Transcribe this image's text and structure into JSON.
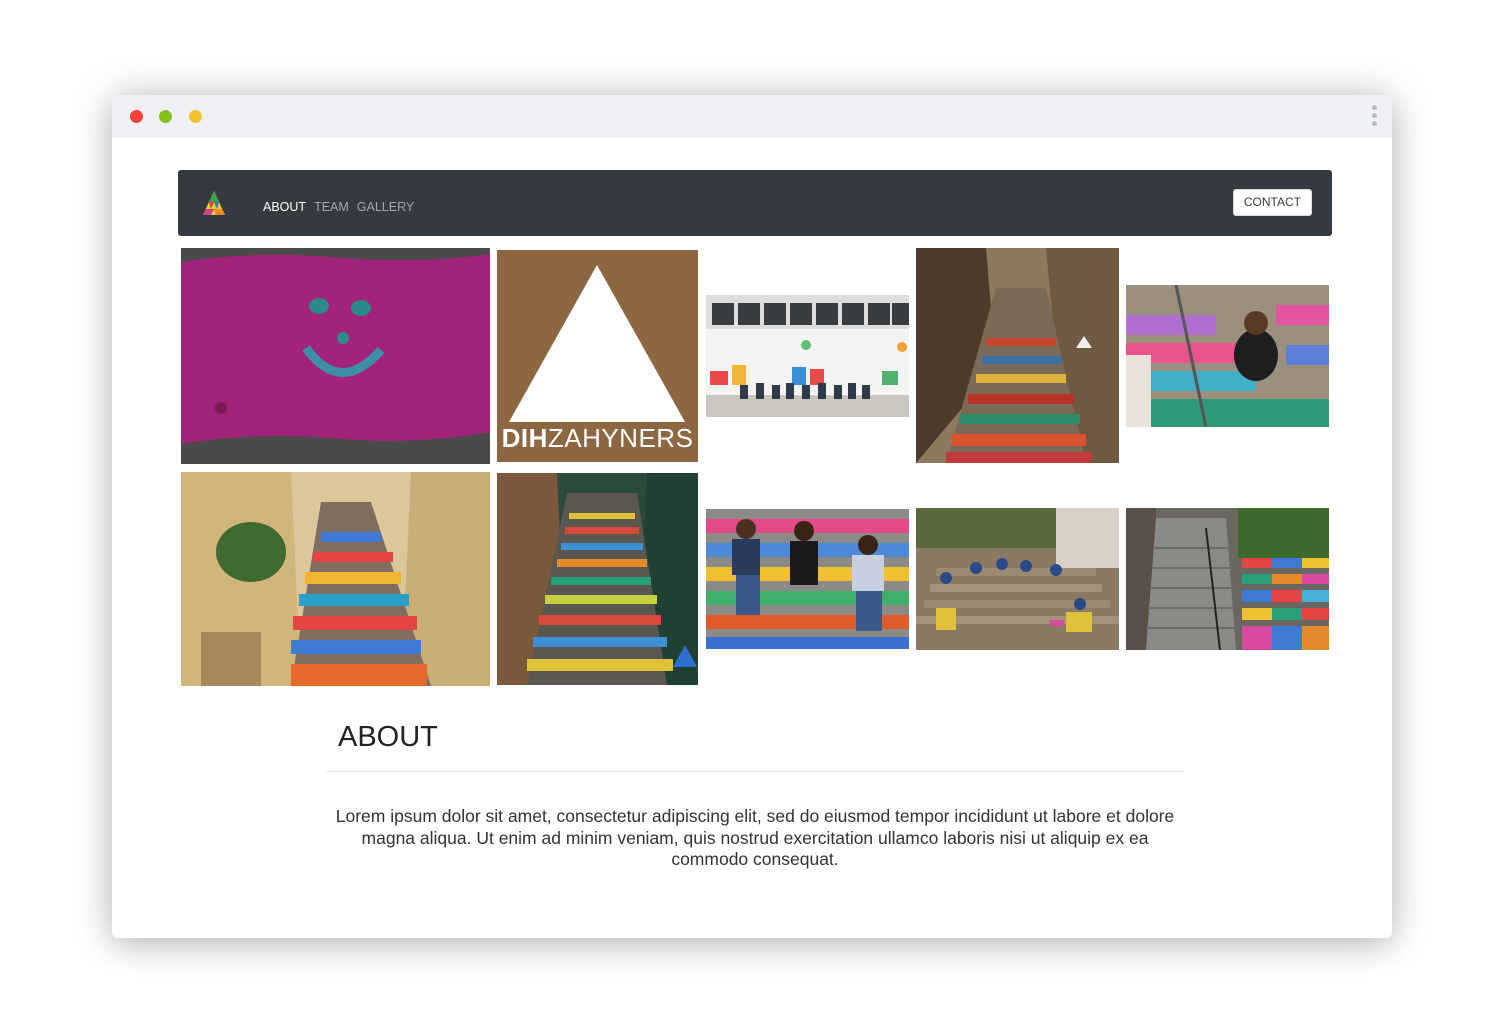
{
  "navbar": {
    "links": [
      "ABOUT",
      "TEAM",
      "GALLERY"
    ],
    "active_link": "ABOUT",
    "contact_label": "CONTACT"
  },
  "gallery": {
    "logo_tile_text": {
      "bold": "DIH",
      "light": "ZAHYNERS"
    }
  },
  "about": {
    "title": "ABOUT",
    "body": "Lorem ipsum dolor sit amet, consectetur adipiscing elit, sed do eiusmod tempor incididunt ut labore et dolore magna aliqua. Ut enim ad minim veniam, quis nostrud exercitation ullamco laboris nisi ut aliquip ex ea commodo consequat."
  },
  "colors": {
    "navbar_bg": "#343a40",
    "window_dot_red": "#f0413b",
    "window_dot_green": "#85c21c",
    "window_dot_yellow": "#f1c232",
    "logo_tile_bg": "#8c6742"
  }
}
